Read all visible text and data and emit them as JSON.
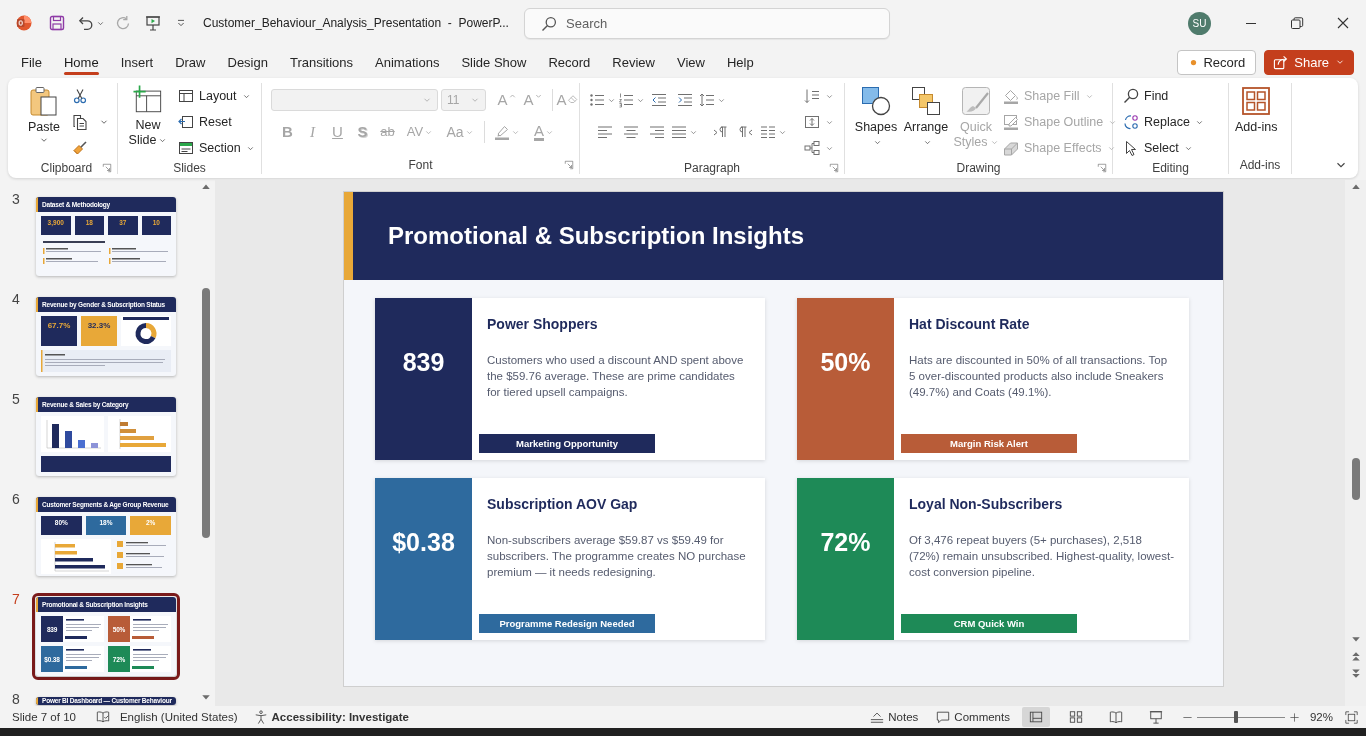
{
  "title_bar": {
    "document_title": "Customer_Behaviour_Analysis_Presentation  -  PowerP...",
    "search": {
      "placeholder": "Search"
    },
    "account": {
      "initials": "SU"
    }
  },
  "menu_tabs": [
    {
      "label": "File",
      "selected": false
    },
    {
      "label": "Home",
      "selected": true
    },
    {
      "label": "Insert",
      "selected": false
    },
    {
      "label": "Draw",
      "selected": false
    },
    {
      "label": "Design",
      "selected": false
    },
    {
      "label": "Transitions",
      "selected": false
    },
    {
      "label": "Animations",
      "selected": false
    },
    {
      "label": "Slide Show",
      "selected": false
    },
    {
      "label": "Record",
      "selected": false
    },
    {
      "label": "Review",
      "selected": false
    },
    {
      "label": "View",
      "selected": false
    },
    {
      "label": "Help",
      "selected": false
    }
  ],
  "header_buttons": [
    {
      "label": "Record",
      "kind": "record"
    },
    {
      "label": "Share",
      "kind": "share"
    }
  ],
  "ribbon": {
    "clipboard": {
      "label": "Clipboard",
      "paste": "Paste"
    },
    "slides": {
      "label": "Slides",
      "new_slide": "New Slide",
      "items": [
        {
          "label": "Layout",
          "kind": "layout",
          "dropdown": true
        },
        {
          "label": "Reset",
          "kind": "reset",
          "dropdown": false
        },
        {
          "label": "Section",
          "kind": "section",
          "dropdown": true
        }
      ]
    },
    "font": {
      "label": "Font",
      "disabled": true,
      "font_size": "11",
      "size_buttons": [
        {
          "glyph": "A",
          "kind": "grow"
        },
        {
          "glyph": "A",
          "kind": "shrink"
        },
        {
          "glyph": "A",
          "kind": "clear"
        }
      ],
      "format_buttons": [
        {
          "glyph": "B",
          "kind": "bold"
        },
        {
          "glyph": "I",
          "kind": "italic"
        },
        {
          "glyph": "U",
          "kind": "underline"
        },
        {
          "glyph": "S",
          "kind": "shadow"
        },
        {
          "glyph": "ab",
          "kind": "strikethrough"
        },
        {
          "glyph": "AV",
          "kind": "spacing"
        },
        {
          "glyph": "Aa",
          "kind": "case"
        },
        {
          "kind": "highlight"
        },
        {
          "glyph": "A",
          "kind": "font_color"
        }
      ]
    },
    "paragraph": {
      "label": "Paragraph"
    },
    "drawing": {
      "label": "Drawing",
      "large": [
        {
          "label": "Shapes",
          "kind": "shapes",
          "disabled": false
        },
        {
          "label": "Arrange",
          "kind": "arrange",
          "disabled": false
        },
        {
          "label": "Quick Styles",
          "kind": "quick_styles",
          "disabled": true
        }
      ],
      "items": [
        {
          "label": "Shape Fill",
          "kind": "fill",
          "disabled": true
        },
        {
          "label": "Shape Outline",
          "kind": "outline",
          "disabled": true
        },
        {
          "label": "Shape Effects",
          "kind": "effects",
          "disabled": true
        }
      ]
    },
    "editing": {
      "label": "Editing",
      "items": [
        {
          "label": "Find",
          "kind": "find",
          "dropdown": false
        },
        {
          "label": "Replace",
          "kind": "replace",
          "dropdown": true
        },
        {
          "label": "Select",
          "kind": "select",
          "dropdown": true
        }
      ]
    },
    "addins": {
      "label": "Add-ins",
      "button": "Add-ins"
    }
  },
  "slide_panel": {
    "thumbnails": [
      {
        "number": "3",
        "selected": false,
        "kind": "stats",
        "title": "Dataset & Methodology",
        "tiles": [
          {
            "value": "3,900"
          },
          {
            "value": "18"
          },
          {
            "value": "37"
          },
          {
            "value": "10"
          }
        ]
      },
      {
        "number": "4",
        "selected": false,
        "kind": "split",
        "title": "Revenue by Gender & Subscription Status",
        "tiles": [
          {
            "value": "67.7%",
            "color": "#1f2a5c"
          },
          {
            "value": "32.3%",
            "color": "#e8a838"
          }
        ]
      },
      {
        "number": "5",
        "selected": false,
        "kind": "charts",
        "title": "Revenue & Sales by Category"
      },
      {
        "number": "6",
        "selected": false,
        "kind": "segments",
        "title": "Customer Segments & Age Group Revenue",
        "tiles": [
          {
            "value": "80%",
            "color": "#1f2a5c"
          },
          {
            "value": "18%",
            "color": "#2e6a9e"
          },
          {
            "value": "2%",
            "color": "#e8a838"
          }
        ]
      },
      {
        "number": "7",
        "selected": true,
        "kind": "insights",
        "title": "Promotional & Subscription Insights",
        "tiles": [
          {
            "value": "839",
            "color": "#1f2a5c"
          },
          {
            "value": "50%",
            "color": "#b85c38"
          },
          {
            "value": "$0.38",
            "color": "#2e6a9e"
          },
          {
            "value": "72%",
            "color": "#1e8a57"
          }
        ]
      },
      {
        "number": "8",
        "selected": false,
        "kind": "title_only",
        "title": "Power BI Dashboard — Customer Behaviour"
      }
    ]
  },
  "slide": {
    "title": "Promotional & Subscription Insights",
    "cards": [
      {
        "value": "839",
        "title": "Power Shoppers",
        "description": "Customers who used a discount AND spent above the $59.76 average. These are prime candidates for tiered upsell campaigns.",
        "tag": "Marketing Opportunity",
        "color": "#1f2a5c"
      },
      {
        "value": "50%",
        "title": "Hat Discount Rate",
        "description": "Hats are discounted in 50% of all transactions. Top 5 over-discounted products also include Sneakers (49.7%) and Coats (49.1%).",
        "tag": "Margin Risk Alert",
        "color": "#b85c38"
      },
      {
        "value": "$0.38",
        "title": "Subscription AOV Gap",
        "description": "Non-subscribers average $59.87 vs $59.49 for subscribers. The programme creates NO purchase premium — it needs redesigning.",
        "tag": "Programme Redesign Needed",
        "color": "#2e6a9e"
      },
      {
        "value": "72%",
        "title": "Loyal Non-Subscribers",
        "description": "Of 3,476 repeat buyers (5+ purchases), 2,518 (72%) remain unsubscribed. Highest-quality, lowest-cost conversion pipeline.",
        "tag": "CRM Quick Win",
        "color": "#1e8a57"
      }
    ]
  },
  "status_bar": {
    "slide_indicator": "Slide 7 of 10",
    "language": "English (United States)",
    "accessibility": "Accessibility: Investigate",
    "notes": "Notes",
    "comments": "Comments",
    "views": [
      {
        "kind": "normal",
        "selected": true
      },
      {
        "kind": "sorter",
        "selected": false
      },
      {
        "kind": "reading",
        "selected": false
      },
      {
        "kind": "slideshow",
        "selected": false
      }
    ],
    "zoom": {
      "level": 0.44,
      "reading": "92%"
    }
  }
}
